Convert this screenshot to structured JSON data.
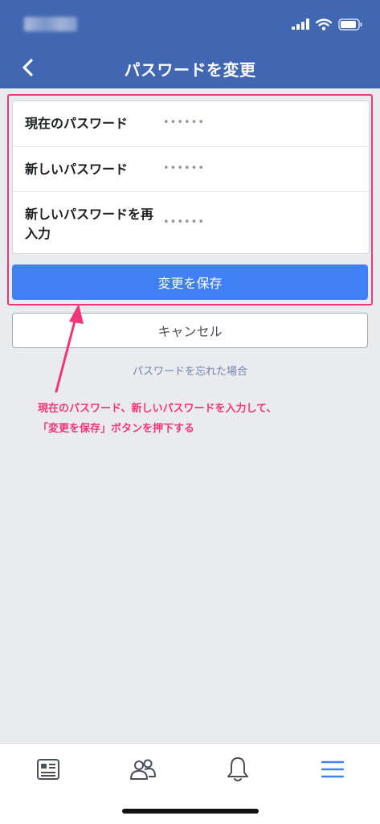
{
  "nav": {
    "title": "パスワードを変更"
  },
  "form": {
    "rows": [
      {
        "label": "現在のパスワード",
        "value": "••••••"
      },
      {
        "label": "新しいパスワード",
        "value": "••••••"
      },
      {
        "label": "新しいパスワードを再入力",
        "value": "••••••"
      }
    ],
    "save_label": "変更を保存",
    "cancel_label": "キャンセル",
    "forgot_label": "パスワードを忘れた場合"
  },
  "annotation": {
    "line1": "現在のパスワード、新しいパスワードを入力して、",
    "line2": "「変更を保存」ボタンを押下する",
    "color": "#f0357a"
  },
  "tabbar": {
    "items": [
      {
        "icon": "news-feed-icon"
      },
      {
        "icon": "friends-icon"
      },
      {
        "icon": "bell-icon"
      },
      {
        "icon": "menu-icon",
        "active": true
      }
    ]
  },
  "colors": {
    "brand": "#4267b2",
    "button": "#4080f6",
    "highlight": "#f0357a"
  }
}
